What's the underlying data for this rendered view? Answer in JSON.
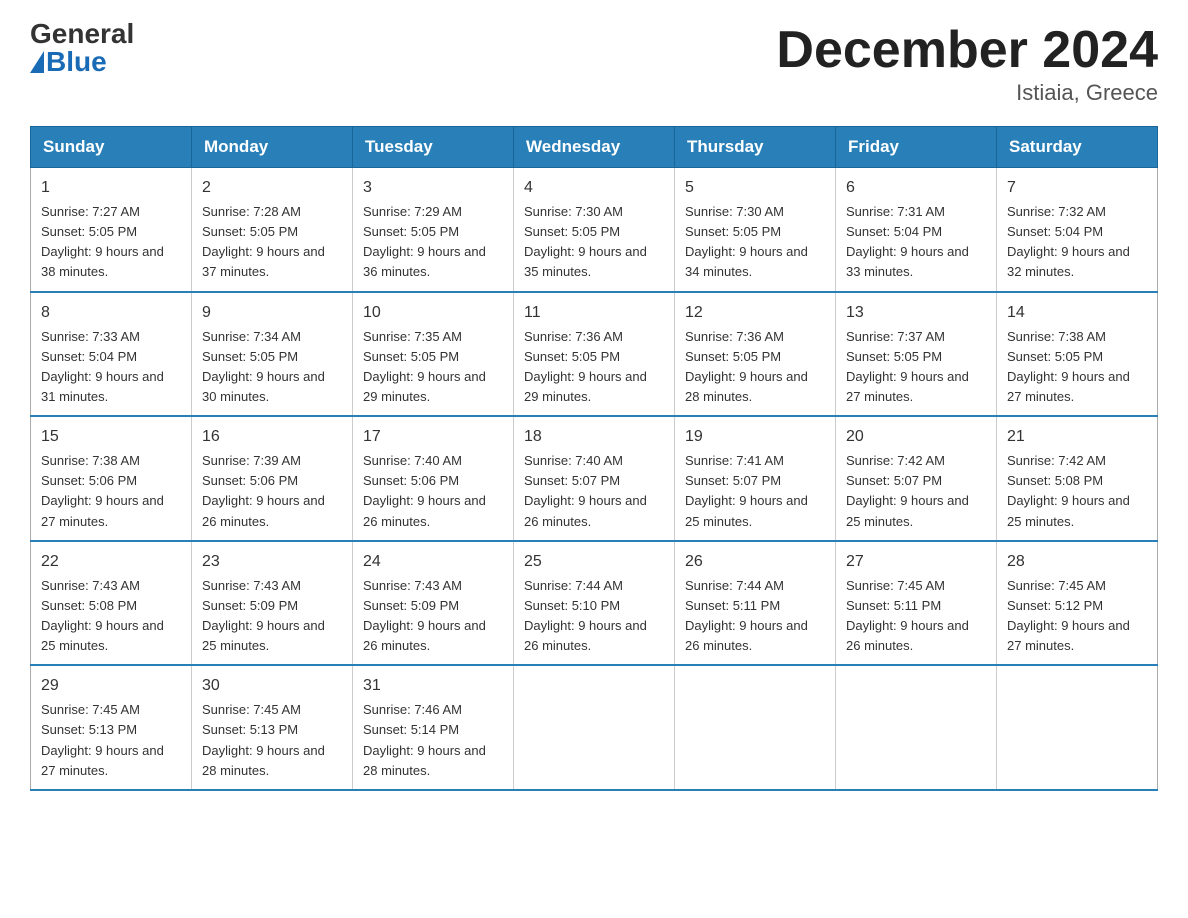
{
  "logo": {
    "general": "General",
    "blue": "Blue"
  },
  "header": {
    "month": "December 2024",
    "location": "Istiaia, Greece"
  },
  "days_of_week": [
    "Sunday",
    "Monday",
    "Tuesday",
    "Wednesday",
    "Thursday",
    "Friday",
    "Saturday"
  ],
  "weeks": [
    [
      {
        "day": 1,
        "sunrise": "7:27 AM",
        "sunset": "5:05 PM",
        "daylight": "9 hours and 38 minutes."
      },
      {
        "day": 2,
        "sunrise": "7:28 AM",
        "sunset": "5:05 PM",
        "daylight": "9 hours and 37 minutes."
      },
      {
        "day": 3,
        "sunrise": "7:29 AM",
        "sunset": "5:05 PM",
        "daylight": "9 hours and 36 minutes."
      },
      {
        "day": 4,
        "sunrise": "7:30 AM",
        "sunset": "5:05 PM",
        "daylight": "9 hours and 35 minutes."
      },
      {
        "day": 5,
        "sunrise": "7:30 AM",
        "sunset": "5:05 PM",
        "daylight": "9 hours and 34 minutes."
      },
      {
        "day": 6,
        "sunrise": "7:31 AM",
        "sunset": "5:04 PM",
        "daylight": "9 hours and 33 minutes."
      },
      {
        "day": 7,
        "sunrise": "7:32 AM",
        "sunset": "5:04 PM",
        "daylight": "9 hours and 32 minutes."
      }
    ],
    [
      {
        "day": 8,
        "sunrise": "7:33 AM",
        "sunset": "5:04 PM",
        "daylight": "9 hours and 31 minutes."
      },
      {
        "day": 9,
        "sunrise": "7:34 AM",
        "sunset": "5:05 PM",
        "daylight": "9 hours and 30 minutes."
      },
      {
        "day": 10,
        "sunrise": "7:35 AM",
        "sunset": "5:05 PM",
        "daylight": "9 hours and 29 minutes."
      },
      {
        "day": 11,
        "sunrise": "7:36 AM",
        "sunset": "5:05 PM",
        "daylight": "9 hours and 29 minutes."
      },
      {
        "day": 12,
        "sunrise": "7:36 AM",
        "sunset": "5:05 PM",
        "daylight": "9 hours and 28 minutes."
      },
      {
        "day": 13,
        "sunrise": "7:37 AM",
        "sunset": "5:05 PM",
        "daylight": "9 hours and 27 minutes."
      },
      {
        "day": 14,
        "sunrise": "7:38 AM",
        "sunset": "5:05 PM",
        "daylight": "9 hours and 27 minutes."
      }
    ],
    [
      {
        "day": 15,
        "sunrise": "7:38 AM",
        "sunset": "5:06 PM",
        "daylight": "9 hours and 27 minutes."
      },
      {
        "day": 16,
        "sunrise": "7:39 AM",
        "sunset": "5:06 PM",
        "daylight": "9 hours and 26 minutes."
      },
      {
        "day": 17,
        "sunrise": "7:40 AM",
        "sunset": "5:06 PM",
        "daylight": "9 hours and 26 minutes."
      },
      {
        "day": 18,
        "sunrise": "7:40 AM",
        "sunset": "5:07 PM",
        "daylight": "9 hours and 26 minutes."
      },
      {
        "day": 19,
        "sunrise": "7:41 AM",
        "sunset": "5:07 PM",
        "daylight": "9 hours and 25 minutes."
      },
      {
        "day": 20,
        "sunrise": "7:42 AM",
        "sunset": "5:07 PM",
        "daylight": "9 hours and 25 minutes."
      },
      {
        "day": 21,
        "sunrise": "7:42 AM",
        "sunset": "5:08 PM",
        "daylight": "9 hours and 25 minutes."
      }
    ],
    [
      {
        "day": 22,
        "sunrise": "7:43 AM",
        "sunset": "5:08 PM",
        "daylight": "9 hours and 25 minutes."
      },
      {
        "day": 23,
        "sunrise": "7:43 AM",
        "sunset": "5:09 PM",
        "daylight": "9 hours and 25 minutes."
      },
      {
        "day": 24,
        "sunrise": "7:43 AM",
        "sunset": "5:09 PM",
        "daylight": "9 hours and 26 minutes."
      },
      {
        "day": 25,
        "sunrise": "7:44 AM",
        "sunset": "5:10 PM",
        "daylight": "9 hours and 26 minutes."
      },
      {
        "day": 26,
        "sunrise": "7:44 AM",
        "sunset": "5:11 PM",
        "daylight": "9 hours and 26 minutes."
      },
      {
        "day": 27,
        "sunrise": "7:45 AM",
        "sunset": "5:11 PM",
        "daylight": "9 hours and 26 minutes."
      },
      {
        "day": 28,
        "sunrise": "7:45 AM",
        "sunset": "5:12 PM",
        "daylight": "9 hours and 27 minutes."
      }
    ],
    [
      {
        "day": 29,
        "sunrise": "7:45 AM",
        "sunset": "5:13 PM",
        "daylight": "9 hours and 27 minutes."
      },
      {
        "day": 30,
        "sunrise": "7:45 AM",
        "sunset": "5:13 PM",
        "daylight": "9 hours and 28 minutes."
      },
      {
        "day": 31,
        "sunrise": "7:46 AM",
        "sunset": "5:14 PM",
        "daylight": "9 hours and 28 minutes."
      },
      null,
      null,
      null,
      null
    ]
  ]
}
